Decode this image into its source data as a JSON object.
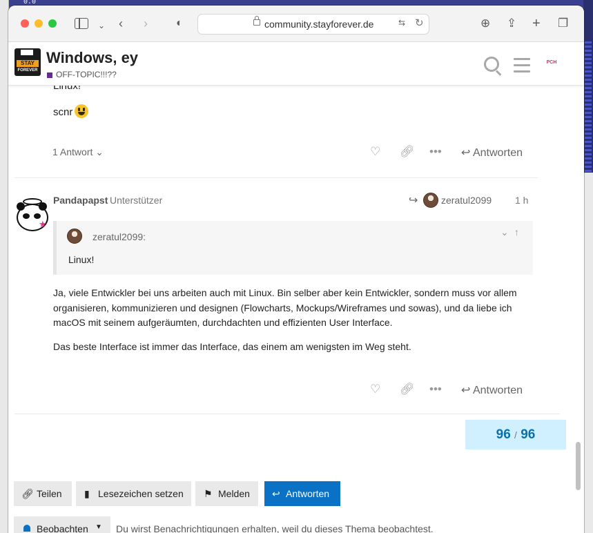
{
  "background": {
    "top_number": "0.0"
  },
  "browser": {
    "url": "community.stayforever.de"
  },
  "header": {
    "logo_line1": "STAY",
    "logo_line2": "FOREVER",
    "topic_title": "Windows, ey",
    "category": "OFF-TOPIC!!!??",
    "category_color": "#652d90",
    "avatar_label": "PCH"
  },
  "post_prev": {
    "fragment": "Linux!",
    "text": "scnr",
    "replies_label": "1 Antwort",
    "reply_label": "Antworten"
  },
  "post": {
    "username": "Pandapapst",
    "user_title": "Unterstützer",
    "reply_to": "zeratul2099",
    "time": "1 h",
    "quote_author": "zeratul2099:",
    "quote_text": "Linux!",
    "paragraphs": [
      "Ja, viele Entwickler bei uns arbeiten auch mit Linux. Bin selber aber kein Entwickler, sondern muss vor allem organisieren, kommunizieren und designen (Flowcharts, Mockups/Wireframes und sowas), und da liebe ich macOS mit seinem aufgeräumten, durchdachten und effizienten User Interface.",
      "Das beste Interface ist immer das Interface, das einem am wenigsten im Weg steht."
    ],
    "reply_label": "Antworten"
  },
  "progress": {
    "current": "96",
    "total": "96",
    "separator": "/"
  },
  "footer": {
    "share": "Teilen",
    "bookmark": "Lesezeichen setzen",
    "flag": "Melden",
    "reply": "Antworten",
    "watch": "Beobachten",
    "notify_text": "Du wirst Benachrichtigungen erhalten, weil du dieses Thema beobachtest."
  },
  "icons": {
    "heart": "heart-icon",
    "link": "link-icon",
    "more": "ellipsis-icon",
    "reply": "reply-icon"
  }
}
